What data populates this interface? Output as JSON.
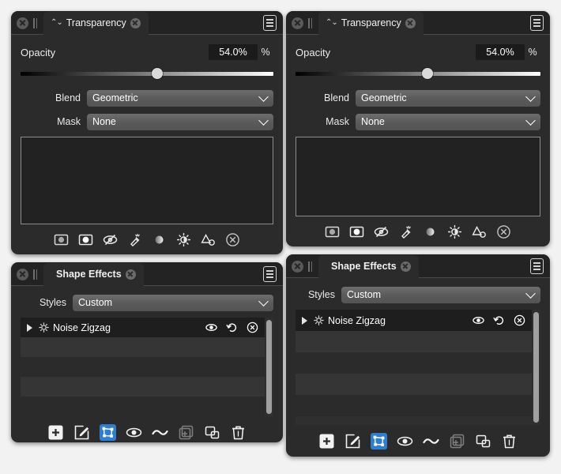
{
  "panels": {
    "transparency_left": {
      "tab": {
        "title": "Transparency",
        "sort_glyph": "⌃⌄"
      },
      "opacity": {
        "label": "Opacity",
        "value": "54.0%",
        "unit": "%",
        "percent": 54
      },
      "blend": {
        "label": "Blend",
        "value": "Geometric"
      },
      "mask": {
        "label": "Mask",
        "value": "None"
      },
      "footer_icons": [
        "gradient-square-icon",
        "mask-square-icon",
        "eye-crossed-icon",
        "eyedropper-icon",
        "gradient-circle-icon",
        "brightness-icon",
        "shapes-icon",
        "close-circle-icon"
      ]
    },
    "transparency_right": {
      "tab": {
        "title": "Transparency",
        "sort_glyph": "⌃⌄"
      },
      "opacity": {
        "label": "Opacity",
        "value": "54.0%",
        "unit": "%",
        "percent": 54
      },
      "blend": {
        "label": "Blend",
        "value": "Geometric"
      },
      "mask": {
        "label": "Mask",
        "value": "None"
      },
      "footer_icons": [
        "gradient-square-icon",
        "mask-square-icon",
        "eye-crossed-icon",
        "eyedropper-icon",
        "gradient-circle-icon",
        "brightness-icon",
        "shapes-icon",
        "close-circle-icon"
      ]
    },
    "shape_effects_left": {
      "tab": {
        "title": "Shape Effects"
      },
      "styles": {
        "label": "Styles",
        "value": "Custom"
      },
      "effects": [
        {
          "name": "Noise Zigzag",
          "selected": true
        }
      ],
      "empty_rows": 4,
      "row_actions": [
        "eye-icon",
        "reset-icon",
        "remove-icon"
      ],
      "footer_icons": [
        "add-icon",
        "edit-icon",
        "node-edit-icon",
        "eye-icon",
        "wave-icon",
        "duplicate-icon",
        "copy-icon",
        "trash-icon"
      ],
      "active_footer_index": 2,
      "dim_footer_index": 5
    },
    "shape_effects_right": {
      "tab": {
        "title": "Shape Effects"
      },
      "styles": {
        "label": "Styles",
        "value": "Custom"
      },
      "effects": [
        {
          "name": "Noise Zigzag",
          "selected": true
        }
      ],
      "empty_rows": 4,
      "row_actions": [
        "eye-icon",
        "reset-icon",
        "remove-icon"
      ],
      "footer_icons": [
        "add-icon",
        "edit-icon",
        "node-edit-icon",
        "eye-icon",
        "wave-icon",
        "duplicate-icon",
        "copy-icon",
        "trash-icon"
      ],
      "active_footer_index": 2,
      "dim_footer_index": 5
    }
  },
  "colors": {
    "panel_bg": "#2b2b2b",
    "tabbar_bg": "#232323",
    "accent": "#2f7fd1",
    "text": "#ffffff",
    "dropdown": "#5a5a5a",
    "row_selected": "#1e1e1e"
  }
}
